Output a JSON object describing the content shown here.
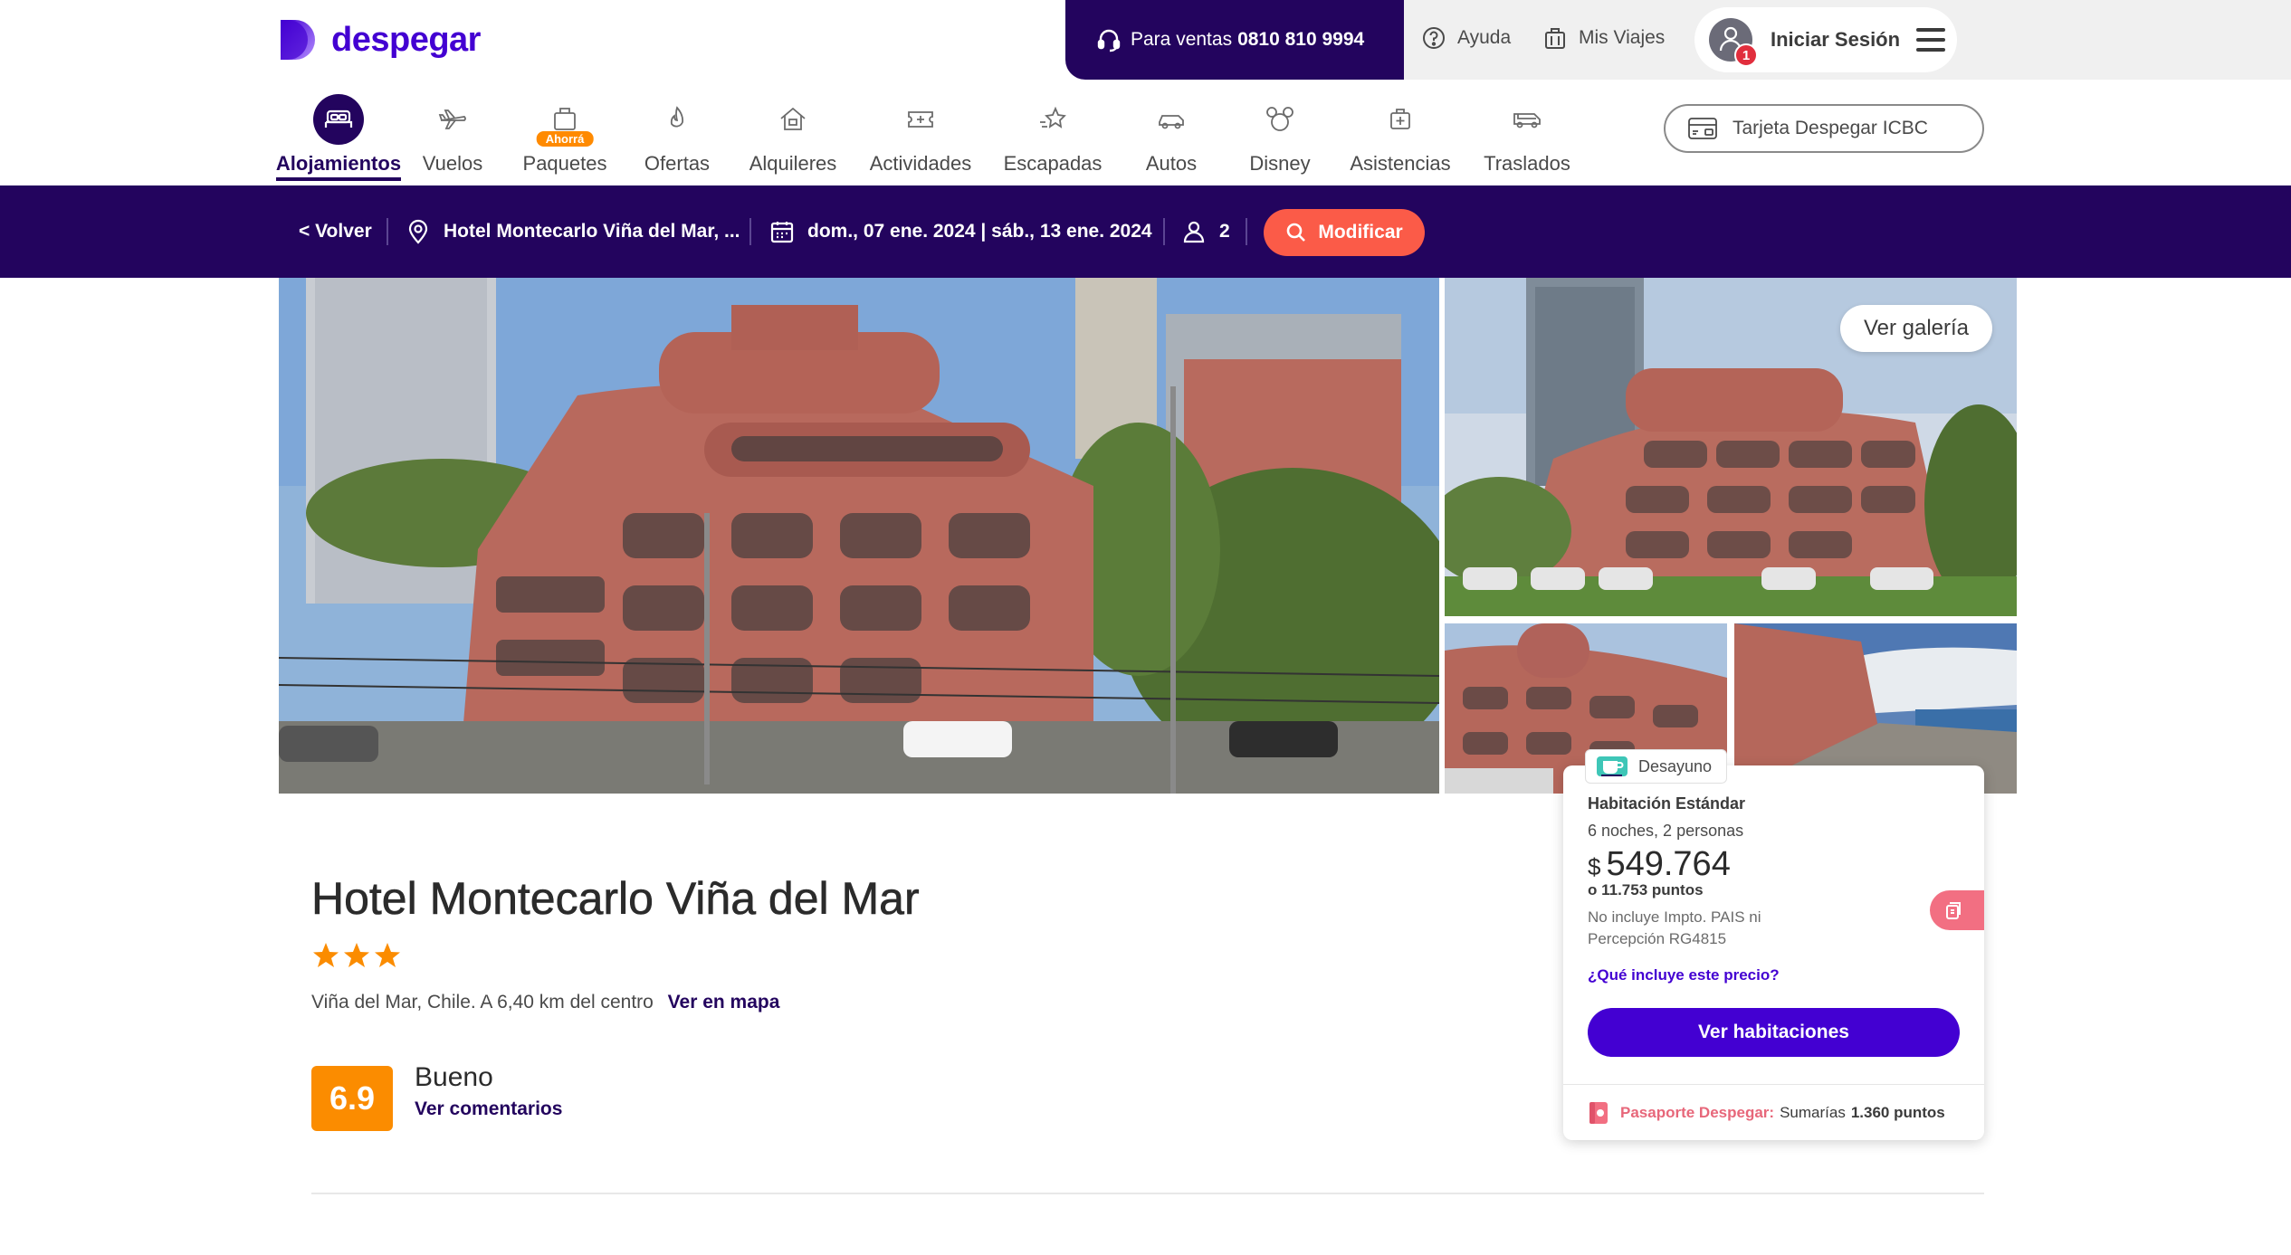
{
  "header": {
    "logo_text": "despegar",
    "sales_prefix": "Para ventas",
    "sales_phone": "0810 810 9994",
    "help_label": "Ayuda",
    "trips_label": "Mis Viajes",
    "login_label": "Iniciar Sesión",
    "notification_count": "1"
  },
  "nav": {
    "items": [
      {
        "label": "Alojamientos",
        "icon": "bed-icon",
        "active": true
      },
      {
        "label": "Vuelos",
        "icon": "plane-icon"
      },
      {
        "label": "Paquetes",
        "icon": "suitcase-icon",
        "badge": "Ahorrá"
      },
      {
        "label": "Ofertas",
        "icon": "flame-icon"
      },
      {
        "label": "Alquileres",
        "icon": "house-icon"
      },
      {
        "label": "Actividades",
        "icon": "ticket-icon"
      },
      {
        "label": "Escapadas",
        "icon": "star-trail-icon"
      },
      {
        "label": "Autos",
        "icon": "car-icon"
      },
      {
        "label": "Disney",
        "icon": "mickey-icon"
      },
      {
        "label": "Asistencias",
        "icon": "medical-bag-icon"
      },
      {
        "label": "Traslados",
        "icon": "bus-icon"
      }
    ],
    "card_label": "Tarjeta Despegar ICBC"
  },
  "search": {
    "back_label": "< Volver",
    "destination": "Hotel Montecarlo Viña del Mar, ...",
    "dates": "dom., 07 ene. 2024 | sáb., 13 ene. 2024",
    "guests": "2",
    "modify_label": "Modificar"
  },
  "gallery": {
    "button_label": "Ver galería"
  },
  "hotel": {
    "name": "Hotel Montecarlo Viña del Mar",
    "stars": 3,
    "location": "Viña del Mar, Chile. A 6,40 km del centro",
    "map_link": "Ver en mapa",
    "rating": "6.9",
    "rating_word": "Bueno",
    "reviews_link": "Ver comentarios"
  },
  "price_card": {
    "breakfast_label": "Desayuno",
    "room_name": "Habitación Estándar",
    "nights": "6 noches, 2 personas",
    "currency": "$",
    "amount": "549.764",
    "points": "o 11.753 puntos",
    "tax_note": "No incluye Impto. PAIS ni Percepción RG4815",
    "price_question": "¿Qué incluye este precio?",
    "button_label": "Ver habitaciones",
    "passport_brand": "Pasaporte Despegar:",
    "passport_text": "Sumarías",
    "passport_points": "1.360 puntos"
  },
  "colors": {
    "brand": "#4300d2",
    "dark": "#23045e",
    "accent": "#fb5b48",
    "rating": "#fb8c00"
  }
}
